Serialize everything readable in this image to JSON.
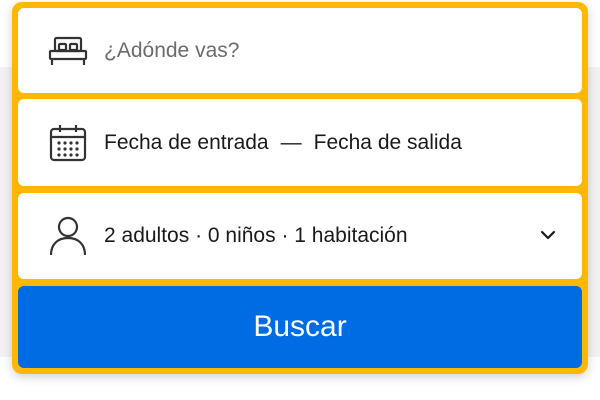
{
  "search": {
    "destination": {
      "placeholder": "¿Adónde vas?",
      "value": "",
      "icon": "bed-icon"
    },
    "dates": {
      "checkin_label": "Fecha de entrada",
      "separator": "—",
      "checkout_label": "Fecha de salida",
      "icon": "calendar-icon"
    },
    "occupancy": {
      "label": "2 adultos · 0 niños · 1 habitación",
      "icon": "person-icon",
      "dropdown_icon": "chevron-down-icon"
    },
    "submit_label": "Buscar"
  },
  "colors": {
    "frame": "#ffb700",
    "button": "#006ce4",
    "button_text": "#ffffff",
    "placeholder_text": "#6b6b6b"
  }
}
